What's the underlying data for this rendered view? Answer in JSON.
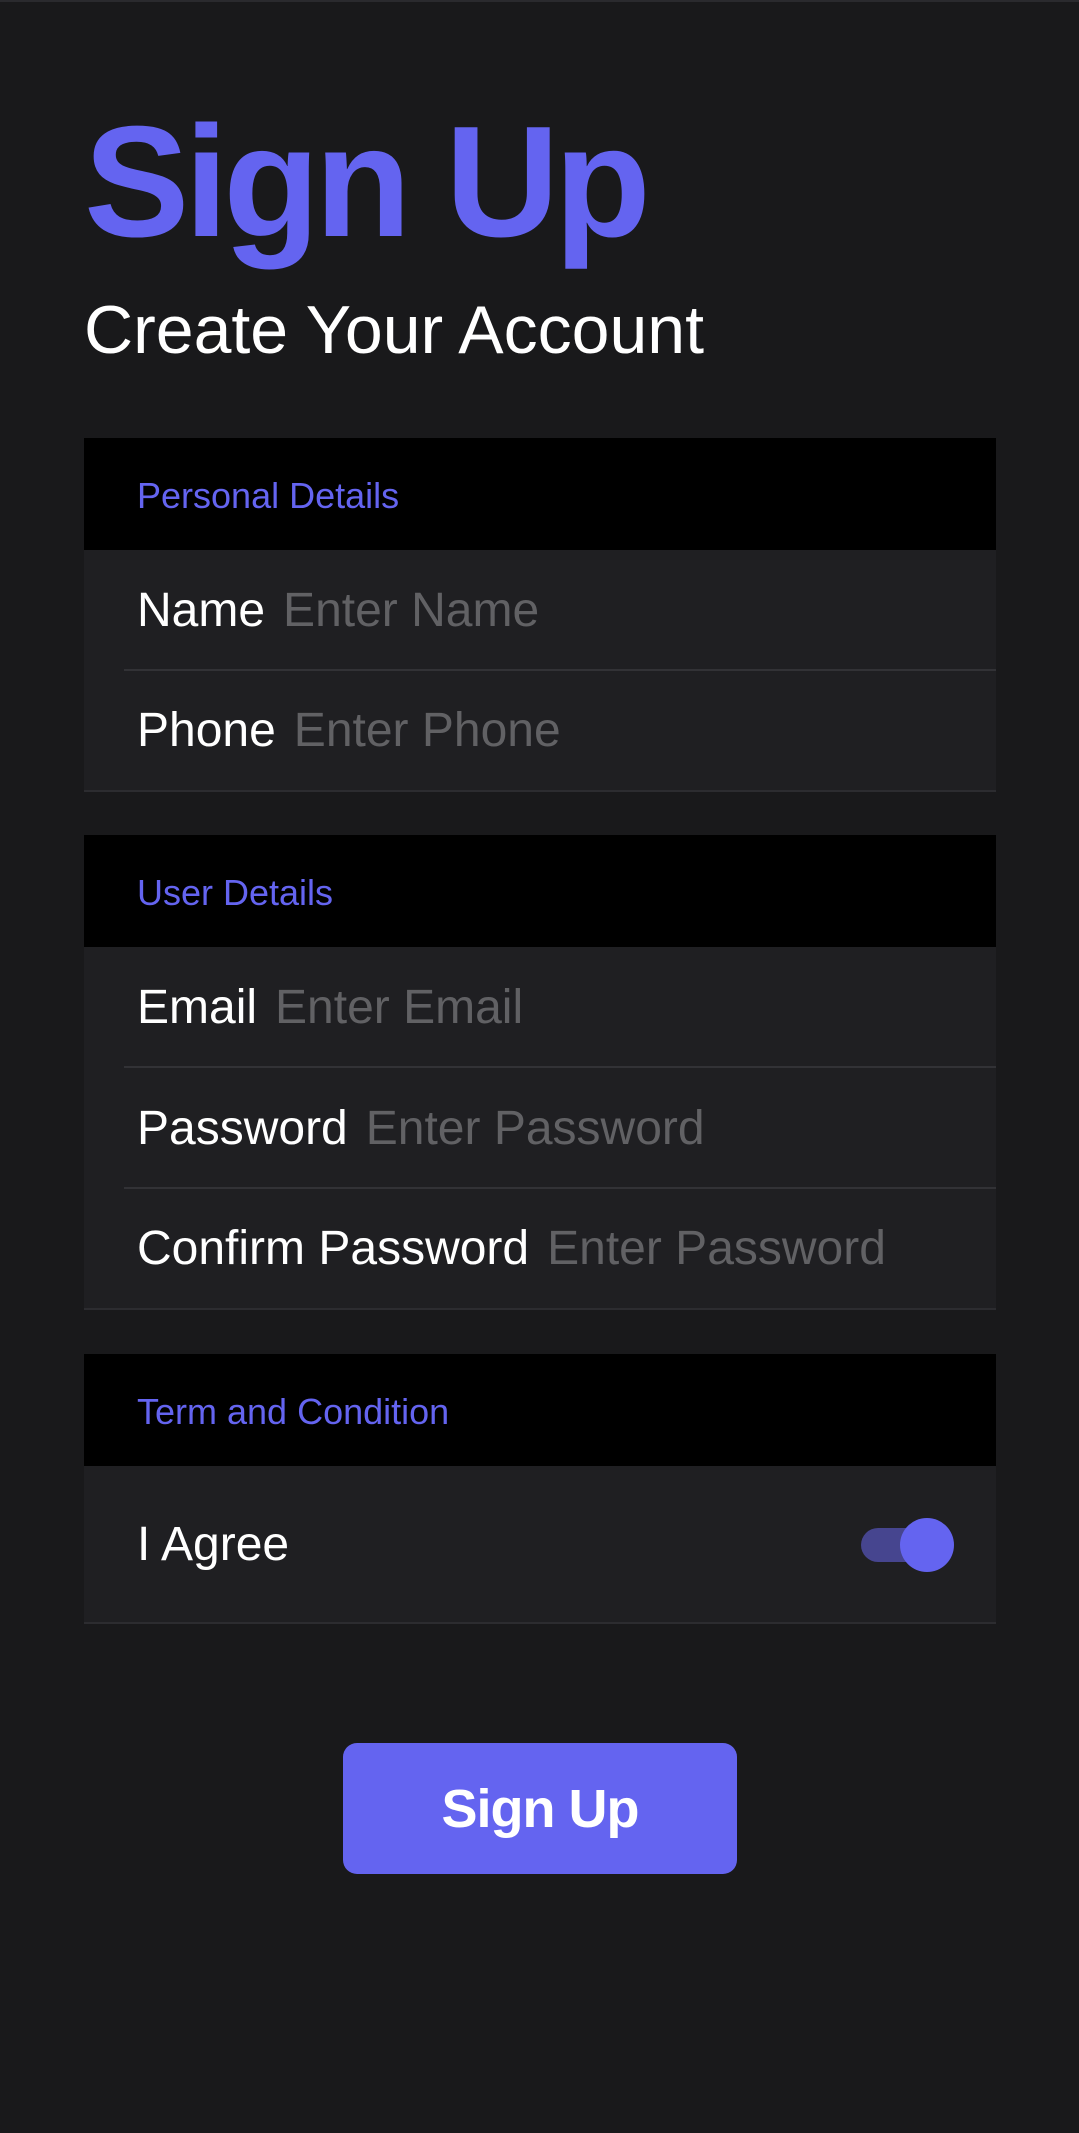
{
  "header": {
    "title": "Sign Up",
    "subtitle": "Create Your Account"
  },
  "personal": {
    "heading": "Personal Details",
    "name": {
      "label": "Name",
      "placeholder": "Enter Name",
      "value": ""
    },
    "phone": {
      "label": "Phone",
      "placeholder": "Enter Phone",
      "value": ""
    }
  },
  "user": {
    "heading": "User Details",
    "email": {
      "label": "Email",
      "placeholder": "Enter Email",
      "value": ""
    },
    "password": {
      "label": "Password",
      "placeholder": "Enter Password",
      "value": ""
    },
    "confirm": {
      "label": "Confirm Password",
      "placeholder": "Enter Password",
      "value": ""
    }
  },
  "terms": {
    "heading": "Term and Condition",
    "agree_label": "I Agree",
    "agree_checked": true
  },
  "actions": {
    "submit_label": "Sign Up"
  },
  "colors": {
    "accent": "#6464f0",
    "background": "#19191b",
    "row_background": "#1f1f22",
    "section_header": "#000000",
    "placeholder": "#616164",
    "toggle_track": "#46458f"
  }
}
